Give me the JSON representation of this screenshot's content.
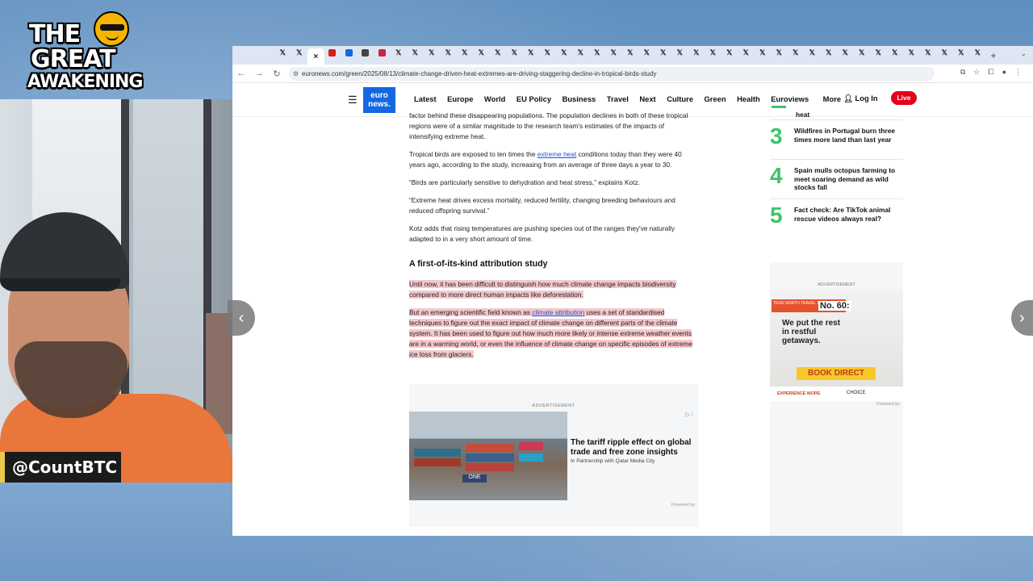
{
  "overlay": {
    "logo_lines": [
      "THE",
      "GREAT",
      "AWAKENING"
    ],
    "handle": "@CountBTC"
  },
  "browser": {
    "url": "euronews.com/green/2025/08/13/climate-change-driven-heat-extremes-are-driving-staggering-decline-in-tropical-birds-study",
    "new_tab_symbol": "+",
    "close_tab_symbol": "×"
  },
  "site": {
    "logo_text": [
      "euro",
      "news."
    ],
    "menu": [
      "Latest",
      "Europe",
      "World",
      "EU Policy",
      "Business",
      "Travel",
      "Next",
      "Culture",
      "Green",
      "Health",
      "Euroviews",
      "More"
    ],
    "login": "Log In",
    "live": "Live"
  },
  "article": {
    "p1": "factor behind these disappearing populations. The population declines in both of these tropical regions were of a similar magnitude to the research team's estimates of the impacts of intensifying extreme heat.",
    "p2_before": "Tropical birds are exposed to ten times the ",
    "p2_link": "extreme heat",
    "p2_after": " conditions today than they were 40 years ago, according to the study, increasing from an average of three days a year to 30.",
    "p3": "“Birds are particularly sensitive to dehydration and heat stress,” explains Kotz.",
    "p4": "“Extreme heat drives excess mortality, reduced fertility, changing breeding behaviours and reduced offspring survival.”",
    "p5": "Kotz adds that rising temperatures are pushing species out of the ranges they've naturally adapted to in a very short amount of time.",
    "heading": "A first-of-its-kind attribution study",
    "p6": "Until now, it has been difficult to distinguish how much climate change impacts biodiversity compared to more direct human impacts like deforestation.",
    "p7_before": "But an emerging scientific field known as ",
    "p7_link": "climate attribution",
    "p7_after": " uses a set of standardised techniques to figure out the exact impact of climate change on different parts of the climate system. It has been used to figure out how much more likely or intense extreme weather events are in a warming world, or even the influence of climate change on specific episodes of extreme ice loss from glaciers."
  },
  "ad_article": {
    "label": "ADVERTISEMENT",
    "title": "The tariff ripple effect on global trade and free zone insights",
    "sub": "In Partnership with Qatar Media City",
    "powered": "Powered by"
  },
  "trending": {
    "top_tail": "heat",
    "items": [
      {
        "num": "3",
        "text": "Wildfires in Portugal burn three times more land than last year"
      },
      {
        "num": "4",
        "text": "Spain mulls octopus farming to meet soaring demand as wild stocks fall"
      },
      {
        "num": "5",
        "text": "Fact check: Are TikTok animal rescue videos always real?"
      }
    ]
  },
  "ad_side": {
    "label": "ADVERTISEMENT",
    "badge": "TRUE NORTH TRAVEL TIP",
    "badge_num": "No. 60:",
    "copy": "We put the rest in restful getaways.",
    "cta": "BOOK DIRECT",
    "exp": "EXPERIENCE MORE",
    "brand": "CHOICE",
    "powered": "Powered by"
  },
  "colors": {
    "accent": "#1467e0",
    "live": "#e2001a",
    "trend_num": "#3cc46b",
    "highlight": "#f5c8cb"
  }
}
